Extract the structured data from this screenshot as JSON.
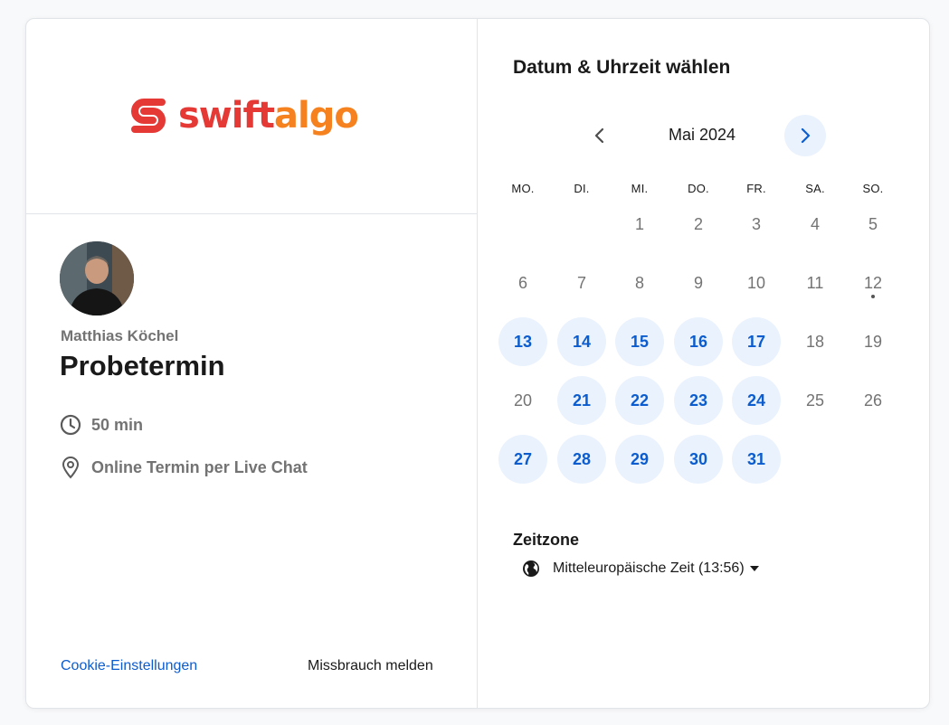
{
  "brand": {
    "logo_text_a": "swift",
    "logo_text_b": "algo"
  },
  "host": {
    "name": "Matthias Köchel"
  },
  "event": {
    "title": "Probetermin",
    "duration": "50 min",
    "location": "Online Termin per Live Chat"
  },
  "footer": {
    "cookie_label": "Cookie-Einstellungen",
    "report_label": "Missbrauch melden"
  },
  "calendar": {
    "heading": "Datum & Uhrzeit wählen",
    "month_label": "Mai 2024",
    "weekdays": [
      "MO.",
      "DI.",
      "MI.",
      "DO.",
      "FR.",
      "SA.",
      "SO."
    ],
    "days": [
      {
        "d": "1",
        "col": 2,
        "row": 0,
        "avail": false
      },
      {
        "d": "2",
        "col": 3,
        "row": 0,
        "avail": false
      },
      {
        "d": "3",
        "col": 4,
        "row": 0,
        "avail": false
      },
      {
        "d": "4",
        "col": 5,
        "row": 0,
        "avail": false
      },
      {
        "d": "5",
        "col": 6,
        "row": 0,
        "avail": false
      },
      {
        "d": "6",
        "col": 0,
        "row": 1,
        "avail": false
      },
      {
        "d": "7",
        "col": 1,
        "row": 1,
        "avail": false
      },
      {
        "d": "8",
        "col": 2,
        "row": 1,
        "avail": false
      },
      {
        "d": "9",
        "col": 3,
        "row": 1,
        "avail": false
      },
      {
        "d": "10",
        "col": 4,
        "row": 1,
        "avail": false
      },
      {
        "d": "11",
        "col": 5,
        "row": 1,
        "avail": false
      },
      {
        "d": "12",
        "col": 6,
        "row": 1,
        "avail": false,
        "today": true
      },
      {
        "d": "13",
        "col": 0,
        "row": 2,
        "avail": true
      },
      {
        "d": "14",
        "col": 1,
        "row": 2,
        "avail": true
      },
      {
        "d": "15",
        "col": 2,
        "row": 2,
        "avail": true
      },
      {
        "d": "16",
        "col": 3,
        "row": 2,
        "avail": true
      },
      {
        "d": "17",
        "col": 4,
        "row": 2,
        "avail": true
      },
      {
        "d": "18",
        "col": 5,
        "row": 2,
        "avail": false
      },
      {
        "d": "19",
        "col": 6,
        "row": 2,
        "avail": false
      },
      {
        "d": "20",
        "col": 0,
        "row": 3,
        "avail": false
      },
      {
        "d": "21",
        "col": 1,
        "row": 3,
        "avail": true
      },
      {
        "d": "22",
        "col": 2,
        "row": 3,
        "avail": true
      },
      {
        "d": "23",
        "col": 3,
        "row": 3,
        "avail": true
      },
      {
        "d": "24",
        "col": 4,
        "row": 3,
        "avail": true
      },
      {
        "d": "25",
        "col": 5,
        "row": 3,
        "avail": false
      },
      {
        "d": "26",
        "col": 6,
        "row": 3,
        "avail": false
      },
      {
        "d": "27",
        "col": 0,
        "row": 4,
        "avail": true
      },
      {
        "d": "28",
        "col": 1,
        "row": 4,
        "avail": true
      },
      {
        "d": "29",
        "col": 2,
        "row": 4,
        "avail": true
      },
      {
        "d": "30",
        "col": 3,
        "row": 4,
        "avail": true
      },
      {
        "d": "31",
        "col": 4,
        "row": 4,
        "avail": true
      }
    ]
  },
  "timezone": {
    "label": "Zeitzone",
    "value": "Mitteleuropäische Zeit (13:56)"
  },
  "colors": {
    "accent": "#0b5cce",
    "available_bg": "#eaf2fd",
    "logo_red": "#e53935",
    "logo_orange": "#f5821f"
  },
  "icons": {
    "clock": "clock-icon",
    "location": "location-pin-icon",
    "globe": "globe-icon",
    "prev": "chevron-left-icon",
    "next": "chevron-right-icon",
    "caret": "caret-down-icon"
  }
}
